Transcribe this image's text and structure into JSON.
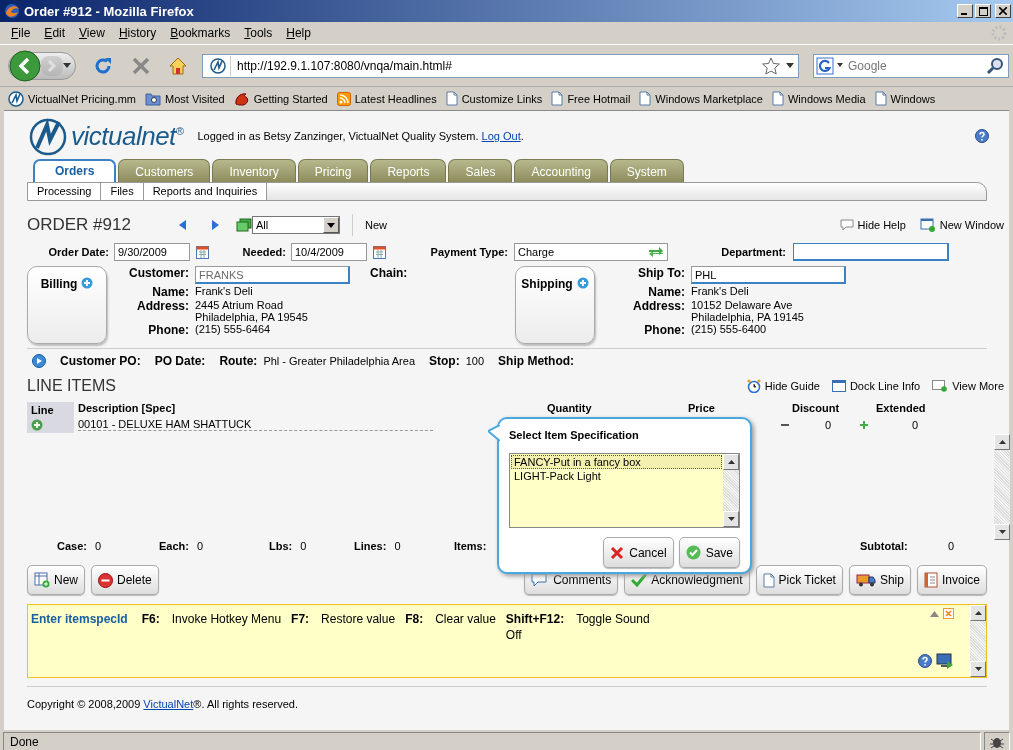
{
  "window": {
    "title": "Order #912 - Mozilla Firefox"
  },
  "menu": [
    "File",
    "Edit",
    "View",
    "History",
    "Bookmarks",
    "Tools",
    "Help"
  ],
  "address_bar": {
    "url": "http://192.9.1.107:8080/vnqa/main.html#"
  },
  "search": {
    "placeholder": "Google"
  },
  "bookmarks": [
    {
      "label": "VictualNet Pricing.mm",
      "kind": "site"
    },
    {
      "label": "Most Visited",
      "kind": "folder"
    },
    {
      "label": "Getting Started",
      "kind": "fox"
    },
    {
      "label": "Latest Headlines",
      "kind": "feed"
    },
    {
      "label": "Customize Links",
      "kind": "page"
    },
    {
      "label": "Free Hotmail",
      "kind": "page"
    },
    {
      "label": "Windows Marketplace",
      "kind": "page"
    },
    {
      "label": "Windows Media",
      "kind": "page"
    },
    {
      "label": "Windows",
      "kind": "page"
    }
  ],
  "header": {
    "logo": "victualnet$^{®}$",
    "login": "Logged in as Betsy Zanzinger, VictualNet Quality System.",
    "logout": "Log Out",
    "after_logout": "."
  },
  "tabs": [
    {
      "label": "Orders",
      "selected": true
    },
    {
      "label": "Customers",
      "selected": false
    },
    {
      "label": "Inventory",
      "selected": false
    },
    {
      "label": "Pricing",
      "selected": false
    },
    {
      "label": "Reports",
      "selected": false
    },
    {
      "label": "Sales",
      "selected": false
    },
    {
      "label": "Accounting",
      "selected": false
    },
    {
      "label": "System",
      "selected": false
    }
  ],
  "subtabs": [
    "Processing",
    "Files",
    "Reports and Inquiries"
  ],
  "order": {
    "title": "ORDER #912",
    "filter": "All",
    "new": "New",
    "hide_help": "Hide Help",
    "new_window": "New Window"
  },
  "dates": {
    "order_date_label": "Order Date:",
    "order_date": "9/30/2009",
    "needed_label": "Needed:",
    "needed": "10/4/2009",
    "payment_label": "Payment Type:",
    "payment": "Charge",
    "department_label": "Department:"
  },
  "billing": {
    "tab": "Billing",
    "input": {
      "label": "Customer:",
      "value": "FRANKS",
      "disabled": true
    },
    "details": [
      {
        "label": "Name:",
        "lines": [
          "Frank's Deli"
        ]
      },
      {
        "label": "Address:",
        "lines": [
          "2445 Atrium Road",
          "Philadelphia, PA 19545"
        ]
      },
      {
        "label": "Phone:",
        "lines": [
          "(215) 555-6464"
        ]
      }
    ],
    "chain_label": "Chain:"
  },
  "shipping": {
    "tab": "Shipping",
    "input": {
      "label": "Ship To:",
      "value": "PHL",
      "disabled": false
    },
    "details": [
      {
        "label": "Name:",
        "lines": [
          "Frank's Deli"
        ]
      },
      {
        "label": "Address:",
        "lines": [
          "10152 Delaware Ave",
          "Philadelphia, PA 19145"
        ]
      },
      {
        "label": "Phone:",
        "lines": [
          "(215) 555-6400"
        ]
      }
    ]
  },
  "po_row": [
    {
      "label": "Customer PO:"
    },
    {
      "label": "PO Date:"
    },
    {
      "label": "Route:",
      "value": "Phl - Greater Philadelphia Area"
    },
    {
      "label": "Stop:",
      "value": "100"
    },
    {
      "label": "Ship Method:"
    }
  ],
  "line_items": {
    "title": "LINE ITEMS",
    "links": [
      {
        "label": "Hide Guide",
        "kind": "clock"
      },
      {
        "label": "Dock Line Info",
        "kind": "window"
      },
      {
        "label": "View More",
        "kind": "more"
      }
    ],
    "columns": [
      "Line",
      "Description [Spec]",
      "Quantity",
      "Price",
      "Discount",
      "Extended"
    ],
    "rows": [
      {
        "description": "00101 - DELUXE HAM SHATTUCK",
        "discount": "0",
        "extended": "0"
      }
    ]
  },
  "totals": [
    {
      "label": "Case:",
      "value": "0"
    },
    {
      "label": "Each:",
      "value": "0"
    },
    {
      "label": "Lbs:",
      "value": "0"
    },
    {
      "label": "Lines:",
      "value": "0"
    },
    {
      "label": "Items:"
    },
    {
      "label": "Subtotal:",
      "value": "0"
    }
  ],
  "actions_left": [
    {
      "label": "New",
      "kind": "new"
    },
    {
      "label": "Delete",
      "kind": "delete"
    }
  ],
  "actions_right": [
    {
      "label": "Comments",
      "kind": "comments"
    },
    {
      "label": "Acknowledgment",
      "kind": "check"
    },
    {
      "label": "Pick Ticket",
      "kind": "page"
    },
    {
      "label": "Ship",
      "kind": "truck"
    },
    {
      "label": "Invoice",
      "kind": "invoice"
    }
  ],
  "hotkeys": {
    "prompt": "Enter itemspecId",
    "items": [
      {
        "key": "F6:",
        "action": "Invoke Hotkey Menu"
      },
      {
        "key": "F7:",
        "action": "Restore value"
      },
      {
        "key": "F8:",
        "action": "Clear value"
      },
      {
        "key": "Shift+F12:",
        "action": "Toggle Sound",
        "note": "Off"
      }
    ]
  },
  "footer": {
    "before": "Copyright © 2008,2009",
    "link": "VictualNet",
    "after": "®. All rights reserved."
  },
  "status_bar": {
    "text": "Done"
  },
  "popup": {
    "title": "Select Item Specification",
    "options": [
      {
        "label": "FANCY-Put in a fancy box",
        "selected": true
      },
      {
        "label": "LIGHT-Pack Light",
        "selected": false
      }
    ],
    "buttons": [
      {
        "label": "Cancel",
        "kind": "cancel"
      },
      {
        "label": "Save",
        "kind": "save"
      }
    ]
  }
}
